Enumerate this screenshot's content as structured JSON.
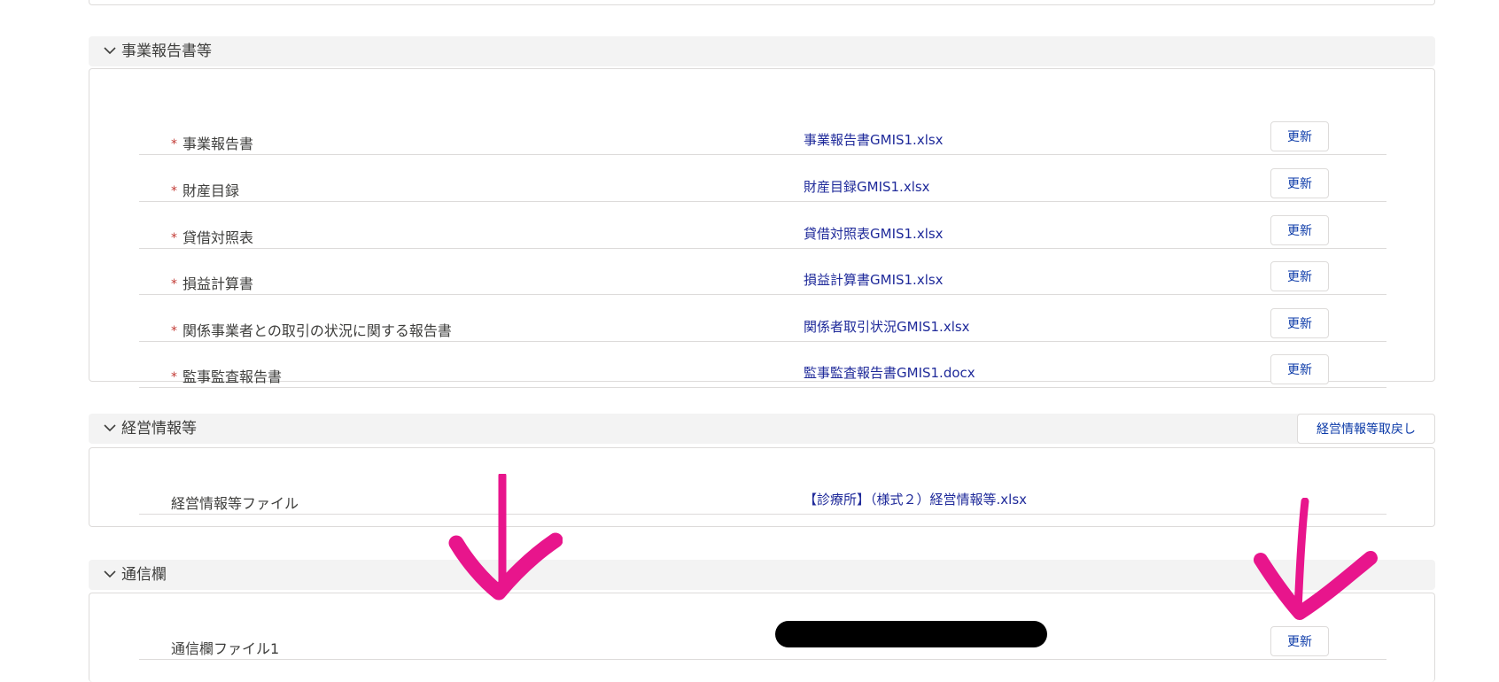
{
  "sections": {
    "reports": {
      "title": "事業報告書等",
      "rows": [
        {
          "label": "事業報告書",
          "required": "*",
          "file": "事業報告書GMIS1.xlsx",
          "button": "更新"
        },
        {
          "label": "財産目録",
          "required": "*",
          "file": "財産目録GMIS1.xlsx",
          "button": "更新"
        },
        {
          "label": "貸借対照表",
          "required": "*",
          "file": "貸借対照表GMIS1.xlsx",
          "button": "更新"
        },
        {
          "label": "損益計算書",
          "required": "*",
          "file": "損益計算書GMIS1.xlsx",
          "button": "更新"
        },
        {
          "label": "関係事業者との取引の状況に関する報告書",
          "required": "*",
          "file": "関係者取引状況GMIS1.xlsx",
          "button": "更新"
        },
        {
          "label": "監事監査報告書",
          "required": "*",
          "file": "監事監査報告書GMIS1.docx",
          "button": "更新"
        }
      ]
    },
    "management": {
      "title": "経営情報等",
      "header_button": "経営情報等取戻し",
      "rows": [
        {
          "label": "経営情報等ファイル",
          "file": "【診療所】（様式２）経営情報等.xlsx"
        }
      ]
    },
    "communication": {
      "title": "通信欄",
      "rows": [
        {
          "label": "通信欄ファイル1",
          "file": "",
          "button": "更新"
        }
      ]
    }
  },
  "icons": {
    "section_toggle": "chevron-down-icon",
    "annotation": "arrow-down-icon"
  },
  "colors": {
    "link": "#1f2a9a",
    "required": "#c23934",
    "button_text": "#0b3aa8",
    "annotation_arrow": "#e8158c",
    "header_bg": "#f3f3f3"
  }
}
